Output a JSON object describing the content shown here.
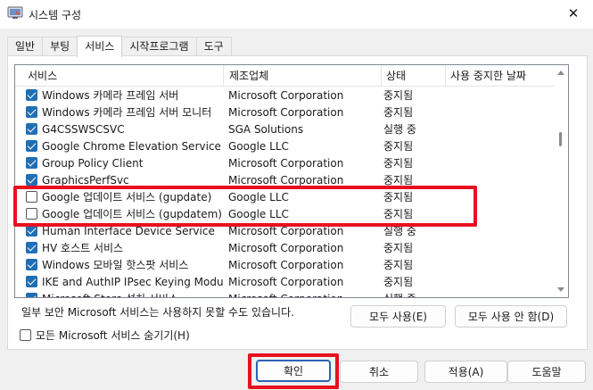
{
  "window": {
    "title": "시스템 구성",
    "close_glyph": "✕"
  },
  "tabs": [
    {
      "label": "일반",
      "active": false
    },
    {
      "label": "부팅",
      "active": false
    },
    {
      "label": "서비스",
      "active": true
    },
    {
      "label": "시작프로그램",
      "active": false
    },
    {
      "label": "도구",
      "active": false
    }
  ],
  "table": {
    "headers": {
      "service": "서비스",
      "vendor": "제조업체",
      "status": "상태",
      "disabled_date": "사용 중지한 날짜"
    },
    "rows": [
      {
        "checked": true,
        "name": "Windows 카메라 프레임 서버",
        "vendor": "Microsoft Corporation",
        "status": "중지됨"
      },
      {
        "checked": true,
        "name": "Windows 카메라 프레임 서버 모니터",
        "vendor": "Microsoft Corporation",
        "status": "중지됨"
      },
      {
        "checked": true,
        "name": "G4CSSWSCSVC",
        "vendor": "SGA Solutions",
        "status": "실행 중"
      },
      {
        "checked": true,
        "name": "Google Chrome Elevation Service (...",
        "vendor": "Google LLC",
        "status": "중지됨"
      },
      {
        "checked": true,
        "name": "Group Policy Client",
        "vendor": "Microsoft Corporation",
        "status": "중지됨"
      },
      {
        "checked": true,
        "name": "GraphicsPerfSvc",
        "vendor": "Microsoft Corporation",
        "status": "중지됨"
      },
      {
        "checked": false,
        "name": "Google 업데이트 서비스 (gupdate)",
        "vendor": "Google LLC",
        "status": "중지됨"
      },
      {
        "checked": false,
        "name": "Google 업데이트 서비스 (gupdatem)",
        "vendor": "Google LLC",
        "status": "중지됨"
      },
      {
        "checked": true,
        "name": "Human Interface Device Service",
        "vendor": "Microsoft Corporation",
        "status": "실행 중"
      },
      {
        "checked": true,
        "name": "HV 호스트 서비스",
        "vendor": "Microsoft Corporation",
        "status": "중지됨"
      },
      {
        "checked": true,
        "name": "Windows 모바일 핫스팟 서비스",
        "vendor": "Microsoft Corporation",
        "status": "중지됨"
      },
      {
        "checked": true,
        "name": "IKE and AuthIP IPsec Keying Modules",
        "vendor": "Microsoft Corporation",
        "status": "중지됨"
      },
      {
        "checked": true,
        "name": "Microsoft Store 설치 서비스",
        "vendor": "Microsoft Corporation",
        "status": "실행 중"
      }
    ]
  },
  "notice": "일부 보안 Microsoft 서비스는 사용하지 못할 수도 있습니다.",
  "buttons": {
    "enable_all": "모두 사용(E)",
    "disable_all": "모두 사용 안 함(D)",
    "ok": "확인",
    "cancel": "취소",
    "apply": "적용(A)",
    "help": "도움말"
  },
  "hide_ms_label": "모든 Microsoft 서비스 숨기기(H)",
  "hide_ms_checked": false,
  "colors": {
    "highlight": "#e8101f",
    "checkbox_checked": "#1f6fb5",
    "primary_border": "#2b64b5"
  }
}
